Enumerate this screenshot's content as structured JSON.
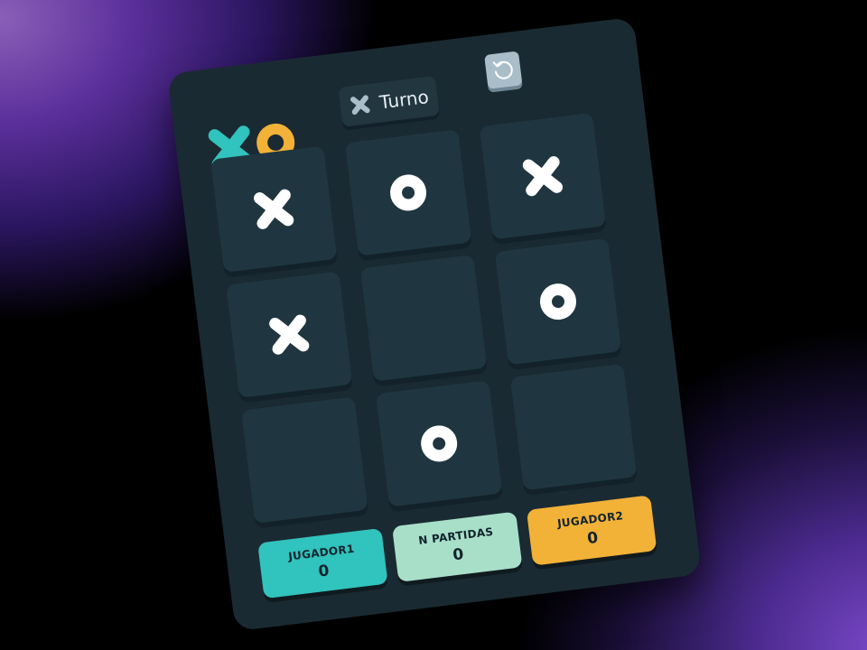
{
  "colors": {
    "x_accent": "#31c3bd",
    "o_accent": "#f2b137",
    "ties": "#a8dfc9",
    "card": "#1a2a32",
    "cell": "#1f3640",
    "mark": "#ffffff"
  },
  "header": {
    "logo_icon": "xo-logo-icon",
    "turn_symbol": "X",
    "turn_label": "Turno",
    "reset_icon": "restart-icon"
  },
  "board": {
    "cells": [
      "X",
      "O",
      "X",
      "X",
      "",
      "O",
      "",
      "O",
      ""
    ]
  },
  "scores": {
    "player1": {
      "label": "JUGADOR1",
      "value": "0"
    },
    "games": {
      "label": "N PARTIDAS",
      "value": "0"
    },
    "player2": {
      "label": "JUGADOR2",
      "value": "0"
    }
  }
}
